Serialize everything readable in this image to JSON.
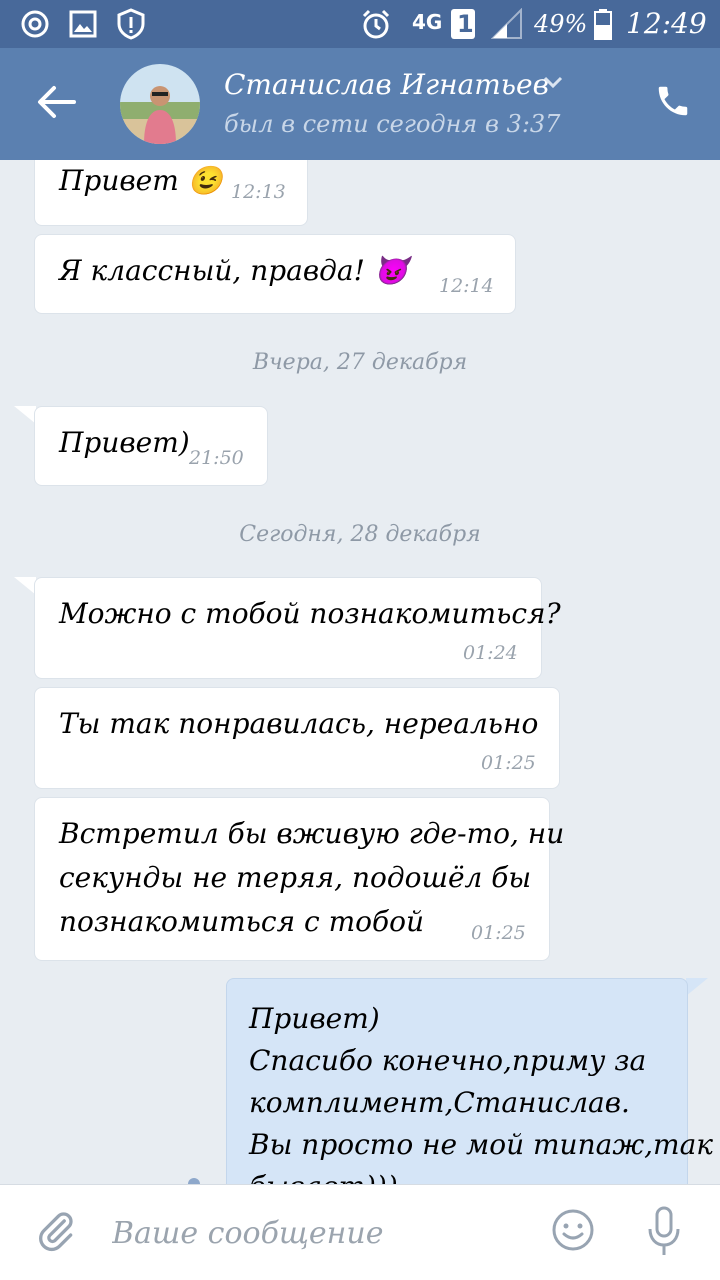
{
  "status_bar": {
    "network": "4G",
    "sim": "1",
    "battery": "49%",
    "time": "12:49"
  },
  "header": {
    "contact_name": "Станислав Игнатьев",
    "last_seen": "был в сети сегодня в 3:37"
  },
  "messages": [
    {
      "type": "in",
      "text": "Привет 😉",
      "time": "12:13"
    },
    {
      "type": "in",
      "text": "Я классный, правда! 😈",
      "time": "12:14"
    },
    {
      "type": "date",
      "text": "Вчера, 27 декабря"
    },
    {
      "type": "in",
      "text": "Привет)",
      "time": "21:50"
    },
    {
      "type": "date",
      "text": "Сегодня, 28 декабря"
    },
    {
      "type": "in",
      "text": "Можно с тобой познакомиться?",
      "time": "01:24"
    },
    {
      "type": "in",
      "text": "Ты так понравилась, нереально",
      "time": "01:25"
    },
    {
      "type": "in",
      "lines": [
        "Встретил бы вживую где-то, ни",
        "секунды не теряя, подошёл бы",
        "познакомиться с тобой"
      ],
      "time": "01:25"
    },
    {
      "type": "out",
      "lines": [
        "Привет)",
        "Спасибо конечно,приму за",
        "комплимент,Станислав.",
        "Вы просто не мой типаж,так",
        "бывает)))"
      ]
    }
  ],
  "input": {
    "placeholder": "Ваше сообщение"
  },
  "colors": {
    "status_bar": "#48699a",
    "header": "#5b80b0",
    "chat_bg": "#e8edf2",
    "outgoing_bubble": "#d5e5f7"
  }
}
